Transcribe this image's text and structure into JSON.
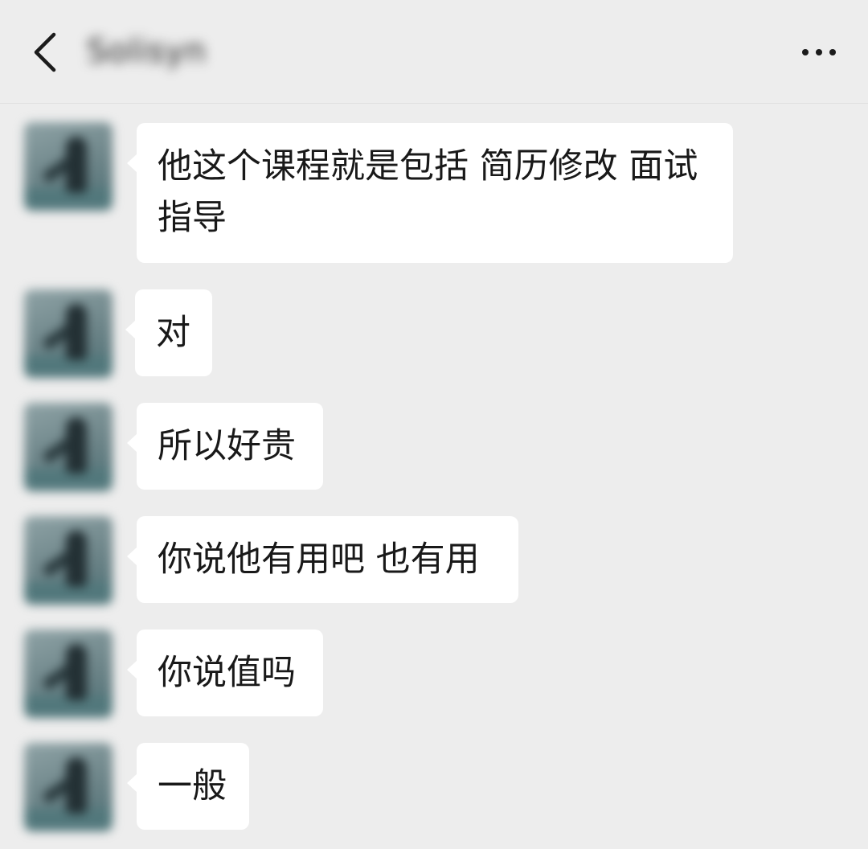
{
  "header": {
    "contact_name": "Solisyn",
    "back_icon": "chevron-left-icon",
    "more_icon": "more-dots-icon"
  },
  "messages": [
    {
      "text_line1": "他这个课程就是包括 简历修改 面试",
      "text_line2": "指导"
    },
    {
      "text": "对"
    },
    {
      "text": "所以好贵"
    },
    {
      "text": "你说他有用吧 也有用"
    },
    {
      "text": "你说值吗"
    },
    {
      "text": "一般"
    }
  ],
  "colors": {
    "background": "#ededed",
    "bubble": "#ffffff",
    "text": "#191919"
  }
}
